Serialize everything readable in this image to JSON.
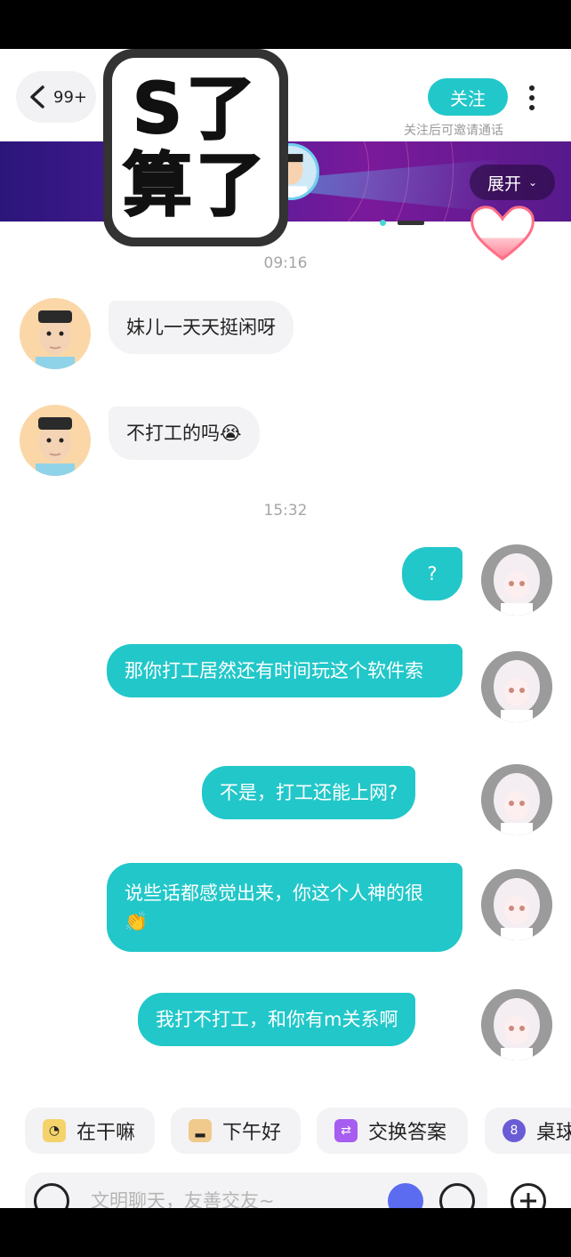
{
  "header": {
    "back_count": "99+",
    "follow_label": "关注",
    "follow_hint": "关注后可邀请通话"
  },
  "banner": {
    "expand_label": "展开"
  },
  "sticker": {
    "line1": "S了",
    "line2": "算了"
  },
  "messages": {
    "time_1": "09:16",
    "time_2": "15:32",
    "m1": "妹儿一天天挺闲呀",
    "m2": "不打工的吗😭",
    "m3": "?",
    "m4": "那你打工居然还有时间玩这个软件索",
    "m5": "不是，打工还能上网?",
    "m6": "说些话都感觉出来，你这个人神的很👏",
    "m7": "我打不打工，和你有m关系啊"
  },
  "quick_replies": [
    {
      "label": "在干嘛",
      "icon": "waving-emoji-icon"
    },
    {
      "label": "下午好",
      "icon": "pudding-icon"
    },
    {
      "label": "交换答案",
      "icon": "swap-icon"
    },
    {
      "label": "桌球",
      "icon": "billiard-icon"
    }
  ],
  "input": {
    "placeholder": "文明聊天，友善交友~"
  },
  "colors": {
    "accent": "#22c7c9",
    "bubble_in": "#f3f3f5",
    "banner_start": "#2b157a",
    "banner_end": "#7a1a9b"
  }
}
